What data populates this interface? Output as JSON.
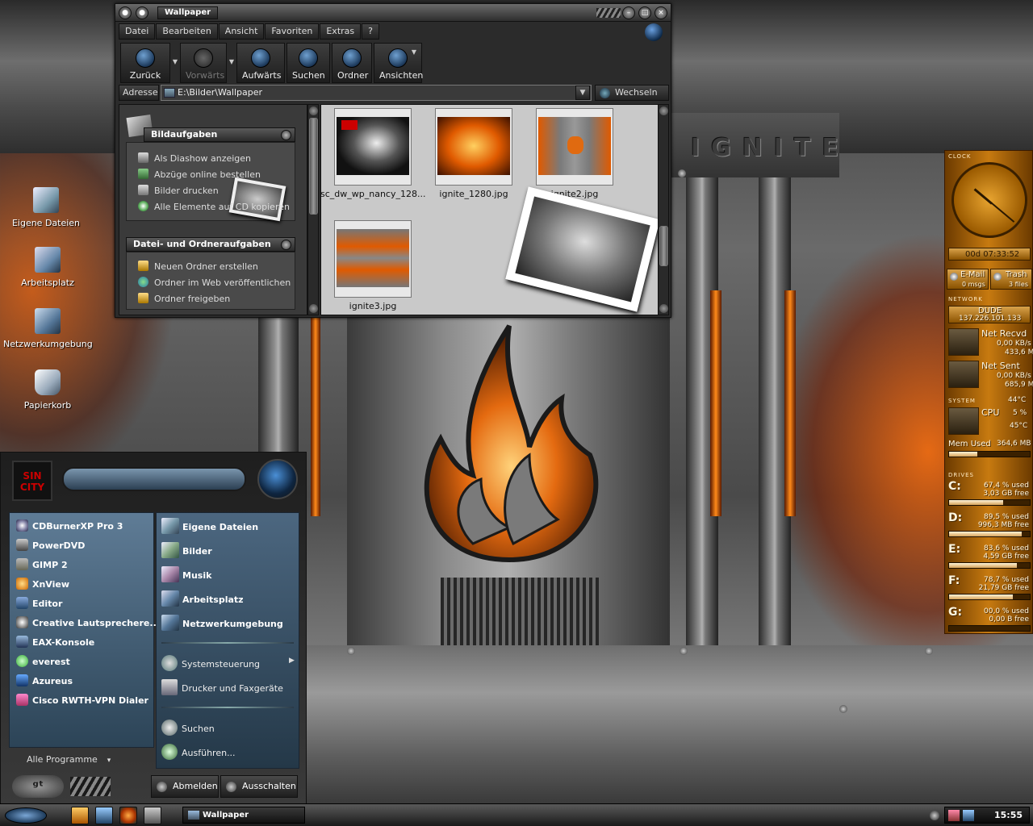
{
  "desktop": {
    "wallpaper_text": "IGNITE",
    "icons": [
      {
        "label": "Eigene Dateien",
        "icon": "my-documents-icon"
      },
      {
        "label": "Arbeitsplatz",
        "icon": "my-computer-icon"
      },
      {
        "label": "Netzwerkumgebung",
        "icon": "network-icon"
      },
      {
        "label": "Papierkorb",
        "icon": "recycle-bin-icon"
      }
    ]
  },
  "explorer": {
    "title": "Wallpaper",
    "menu": [
      "Datei",
      "Bearbeiten",
      "Ansicht",
      "Favoriten",
      "Extras",
      "?"
    ],
    "toolbar": [
      {
        "label": "Zurück",
        "icon": "back-arrow-icon"
      },
      {
        "label": "Vorwärts",
        "icon": "forward-arrow-icon"
      },
      {
        "label": "Aufwärts",
        "icon": "up-arrow-icon"
      },
      {
        "label": "Suchen",
        "icon": "search-icon"
      },
      {
        "label": "Ordner",
        "icon": "folder-icon"
      },
      {
        "label": "Ansichten",
        "icon": "views-icon"
      }
    ],
    "address": {
      "label": "Adresse",
      "value": "E:\\Bilder\\Wallpaper",
      "go_label": "Wechseln zu"
    },
    "task_groups": [
      {
        "title": "Bildaufgaben",
        "items": [
          "Als Diashow anzeigen",
          "Abzüge online bestellen",
          "Bilder drucken",
          "Alle Elemente auf CD kopieren"
        ]
      },
      {
        "title": "Datei- und Ordneraufgaben",
        "items": [
          "Neuen Ordner erstellen",
          "Ordner im Web veröffentlichen",
          "Ordner freigeben"
        ]
      }
    ],
    "files": [
      {
        "name": "sc_dw_wp_nancy_128..."
      },
      {
        "name": "ignite_1280.jpg"
      },
      {
        "name": "ignite2.jpg"
      },
      {
        "name": "ignite3.jpg"
      }
    ]
  },
  "start_menu": {
    "logo_text": "SIN CITY",
    "programs": [
      "CDBurnerXP Pro 3",
      "PowerDVD",
      "GIMP 2",
      "XnView",
      "Editor",
      "Creative Lautsprechere...",
      "EAX-Konsole",
      "everest",
      "Azureus",
      "Cisco RWTH-VPN Dialer"
    ],
    "places": [
      "Eigene Dateien",
      "Bilder",
      "Musik",
      "Arbeitsplatz",
      "Netzwerkumgebung"
    ],
    "system": [
      "Systemsteuerung",
      "Drucker und Faxgeräte"
    ],
    "tools": [
      "Suchen",
      "Ausführen..."
    ],
    "all_programs": "Alle Programme",
    "logoff": "Abmelden",
    "shutdown": "Ausschalten"
  },
  "taskbar": {
    "active_window": "Wallpaper",
    "clock": "15:55"
  },
  "sidebar": {
    "clock_tag": "CLOCK",
    "uptime": "00d 07:33:52",
    "email": {
      "label": "E-Mail",
      "sub": "0 msgs"
    },
    "trash": {
      "label": "Trash",
      "sub": "3 files"
    },
    "network_tag": "NETWORK",
    "host": "DUDE",
    "ip": "137.226.101.133",
    "recv": {
      "label": "Net Recvd",
      "rate": "0,00 KB/s",
      "total": "433,6 MB"
    },
    "sent": {
      "label": "Net Sent",
      "rate": "0,00 KB/s",
      "total": "685,9 MB"
    },
    "system_tag": "SYSTEM",
    "temp1": "44°C",
    "cpu_label": "CPU",
    "cpu": "5 %",
    "temp2": "45°C",
    "mem_label": "Mem Used",
    "mem": "364,6 MB",
    "mem_fraction": 0.35,
    "drives_tag": "DRIVES",
    "drives": [
      {
        "letter": "C:",
        "used": "67,4 % used",
        "free": "3,03 GB free",
        "fraction": 0.674
      },
      {
        "letter": "D:",
        "used": "89,5 % used",
        "free": "996,3 MB free",
        "fraction": 0.895
      },
      {
        "letter": "E:",
        "used": "83,6 % used",
        "free": "4,59 GB free",
        "fraction": 0.836
      },
      {
        "letter": "F:",
        "used": "78,7 % used",
        "free": "21,79 GB free",
        "fraction": 0.787
      },
      {
        "letter": "G:",
        "used": "00,0 % used",
        "free": "0,00 B free",
        "fraction": 0.0
      }
    ]
  }
}
